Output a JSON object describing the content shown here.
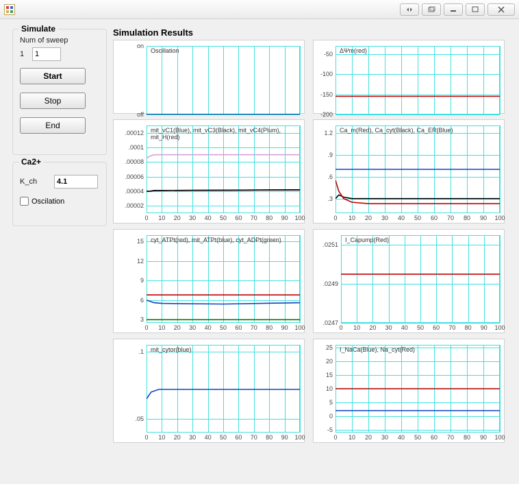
{
  "window": {
    "title": ""
  },
  "simulate": {
    "legend": "Simulate",
    "sweep_label": "Num of sweep",
    "sweep_index": "1",
    "sweep_value": "1",
    "start": "Start",
    "stop": "Stop",
    "end": "End"
  },
  "ca2": {
    "legend": "Ca2+",
    "kch_label": "K_ch",
    "kch_value": "4.1",
    "osc_label": "Oscilation",
    "osc_checked": false
  },
  "results_label": "Simulation Results",
  "xaxis": {
    "min": 0,
    "max": 100,
    "ticks": [
      0,
      10,
      20,
      30,
      40,
      50,
      60,
      70,
      80,
      90,
      100
    ]
  },
  "chart_data": [
    {
      "id": "osc",
      "type": "line",
      "title": "Oscillation",
      "ylabels_left": [
        "on",
        "off"
      ],
      "yticks": [
        1,
        0
      ],
      "ylim": [
        0,
        1
      ],
      "x": [
        0,
        100
      ],
      "series": [
        {
          "name": "state",
          "color": "#000080",
          "values": [
            0,
            0
          ]
        }
      ]
    },
    {
      "id": "dpsi",
      "type": "line",
      "title": "ΔΨm(red)",
      "yticks": [
        -50,
        -100,
        -150,
        -200
      ],
      "ylim": [
        -200,
        -30
      ],
      "x": [
        0,
        100
      ],
      "series": [
        {
          "name": "ΔΨm",
          "color": "#c00000",
          "values": [
            -155,
            -155
          ]
        }
      ]
    },
    {
      "id": "mitvc",
      "type": "line",
      "title": "mit_vC1(Blue), mit_vC3(Black), mit_vC4(Plum), mit_H(red)",
      "yticks": [
        0.00012,
        0.0001,
        8e-05,
        6e-05,
        4e-05,
        2e-05
      ],
      "ylim": [
        1e-05,
        0.00013
      ],
      "x": [
        0,
        2,
        5,
        100
      ],
      "series": [
        {
          "name": "mit_vC4",
          "color": "#d8a0d8",
          "values": [
            8.5e-05,
            8.8e-05,
            9e-05,
            9e-05
          ]
        },
        {
          "name": "mit_H",
          "color": "#c00000",
          "values": [
            4e-05,
            4e-05,
            4.1e-05,
            4.2e-05
          ]
        },
        {
          "name": "mit_vC1",
          "color": "#1040c0",
          "values": [
            4e-05,
            4e-05,
            4.1e-05,
            4.2e-05
          ]
        },
        {
          "name": "mit_vC3",
          "color": "#000000",
          "values": [
            4e-05,
            4e-05,
            4.1e-05,
            4.2e-05
          ]
        }
      ]
    },
    {
      "id": "cam",
      "type": "line",
      "title": "Ca_m(Red), Ca_cyt(Black), Ca_ER(Blue)",
      "yticks": [
        1.2,
        0.9,
        0.6,
        0.3
      ],
      "ylim": [
        0.1,
        1.3
      ],
      "x": [
        0,
        2,
        5,
        10,
        20,
        100
      ],
      "series": [
        {
          "name": "Ca_ER",
          "color": "#1040c0",
          "values": [
            0.7,
            0.7,
            0.7,
            0.7,
            0.7,
            0.7
          ]
        },
        {
          "name": "Ca_cyt",
          "color": "#000000",
          "values": [
            0.3,
            0.35,
            0.32,
            0.3,
            0.3,
            0.3
          ]
        },
        {
          "name": "Ca_m",
          "color": "#c00000",
          "values": [
            0.55,
            0.4,
            0.3,
            0.25,
            0.23,
            0.23
          ]
        }
      ]
    },
    {
      "id": "atp",
      "type": "line",
      "title": "cyt_ATPt(red), mit_ATPt(blue), cyt_ADPt(green)",
      "yticks": [
        15,
        12,
        9,
        6,
        3
      ],
      "ylim": [
        2.5,
        16
      ],
      "x": [
        0,
        5,
        10,
        50,
        100
      ],
      "series": [
        {
          "name": "cyt_ATPt",
          "color": "#c00000",
          "values": [
            6.8,
            6.8,
            6.8,
            6.8,
            6.8
          ]
        },
        {
          "name": "mit_ATPt",
          "color": "#1040c0",
          "values": [
            6.0,
            5.6,
            5.5,
            5.4,
            5.6
          ]
        },
        {
          "name": "cyt_ADPt",
          "color": "#008000",
          "values": [
            3.0,
            3.0,
            3.0,
            3.0,
            3.0
          ]
        }
      ]
    },
    {
      "id": "icapump",
      "type": "line",
      "title": "I_Capump(Red)",
      "yticks": [
        0.0251,
        0.0249,
        0.0247
      ],
      "ylim": [
        0.0247,
        0.02515
      ],
      "x": [
        0,
        2,
        100
      ],
      "series": [
        {
          "name": "I_Capump",
          "color": "#c00000",
          "values": [
            0.02495,
            0.02495,
            0.02495
          ]
        }
      ]
    },
    {
      "id": "cytor",
      "type": "line",
      "title": "mit_cytor(blue)",
      "yticks": [
        0.1,
        0.05
      ],
      "ylim": [
        0.04,
        0.105
      ],
      "x": [
        0,
        3,
        8,
        100
      ],
      "series": [
        {
          "name": "mit_cytor",
          "color": "#1040c0",
          "values": [
            0.065,
            0.07,
            0.072,
            0.072
          ]
        }
      ]
    },
    {
      "id": "inaca",
      "type": "line",
      "title": "I_NaCa(Blue),  Na_cyt(Red)",
      "yticks": [
        25,
        20,
        15,
        10,
        5,
        0,
        -5
      ],
      "ylim": [
        -6,
        26
      ],
      "x": [
        0,
        100
      ],
      "series": [
        {
          "name": "Na_cyt",
          "color": "#c00000",
          "values": [
            10,
            10
          ]
        },
        {
          "name": "I_NaCa",
          "color": "#1040c0",
          "values": [
            2,
            2
          ]
        }
      ]
    }
  ]
}
